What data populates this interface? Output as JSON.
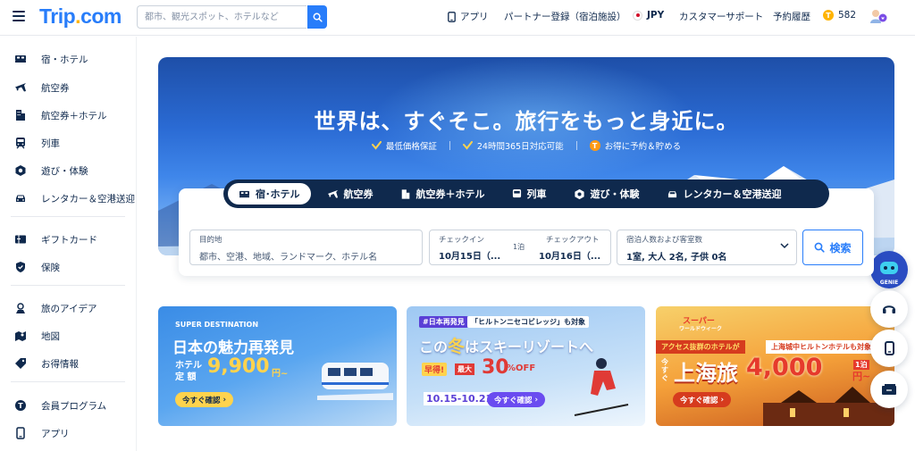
{
  "header": {
    "logo_main": "Trip",
    "logo_dot": ".",
    "logo_tld": "com",
    "search_placeholder": "都市、観光スポット、ホテルなど",
    "app": "アプリ",
    "partner": "パートナー登録（宿泊施設）",
    "currency": "JPY",
    "support": "カスタマーサポート",
    "bookings": "予約履歴",
    "points": "582"
  },
  "sidebar": {
    "items": [
      {
        "label": "宿・ホテル"
      },
      {
        "label": "航空券"
      },
      {
        "label": "航空券＋ホテル"
      },
      {
        "label": "列車"
      },
      {
        "label": "遊び・体験"
      },
      {
        "label": "レンタカー＆空港送迎"
      },
      {
        "label": "ギフトカード"
      },
      {
        "label": "保険"
      },
      {
        "label": "旅のアイデア"
      },
      {
        "label": "地図"
      },
      {
        "label": "お得情報"
      },
      {
        "label": "会員プログラム"
      },
      {
        "label": "アプリ"
      }
    ]
  },
  "hero": {
    "title": "世界は、すぐそこ。旅行をもっと身近に。",
    "perks": [
      "最低価格保証",
      "24時間365日対応可能",
      "お得に予約＆貯める"
    ]
  },
  "tabs": [
    "宿･ホテル",
    "航空券",
    "航空券＋ホテル",
    "列車",
    "遊び・体験",
    "レンタカー＆空港送迎"
  ],
  "search": {
    "destination_label": "目的地",
    "destination_placeholder": "都市、空港、地域、ランドマーク、ホテル名",
    "checkin_label": "チェックイン",
    "checkin_value": "10月15日（...",
    "nights": "1泊",
    "checkout_label": "チェックアウト",
    "checkout_value": "10月16日（...",
    "guests_label": "宿泊人数および客室数",
    "guests_value": "1室, 大人 2名, 子供 0名",
    "button": "検索"
  },
  "promos": [
    {
      "tag": "SUPER DESTINATION",
      "head": "日本の魅力再発見",
      "sub1": "ホテル",
      "sub2": "定 額",
      "price": "9,900",
      "unit": "円~",
      "button": "今すぐ確認"
    },
    {
      "tag": "#日本再発見",
      "tag2": "「ヒルトンニセコビレッジ」も対象",
      "head_a": "この",
      "head_b": "冬",
      "head_c": "はスキーリゾートへ",
      "badge1": "早得!",
      "badge2": "最大",
      "discount": "30",
      "off": "%OFF",
      "dates": "10.15-10.21",
      "button": "今すぐ確認"
    },
    {
      "tag": "スーパー",
      "tag_sub": "ワールドウィーク",
      "ribbon1": "アクセス抜群のホテルが",
      "ribbon2": "上海城中ヒルトンホテルも対象",
      "pre": "今すぐ",
      "head": "上海旅",
      "price": "4,000",
      "unit": "円~",
      "per": "1泊",
      "button": "今すぐ確認"
    }
  ],
  "fab": {
    "genie": "GENIE"
  }
}
